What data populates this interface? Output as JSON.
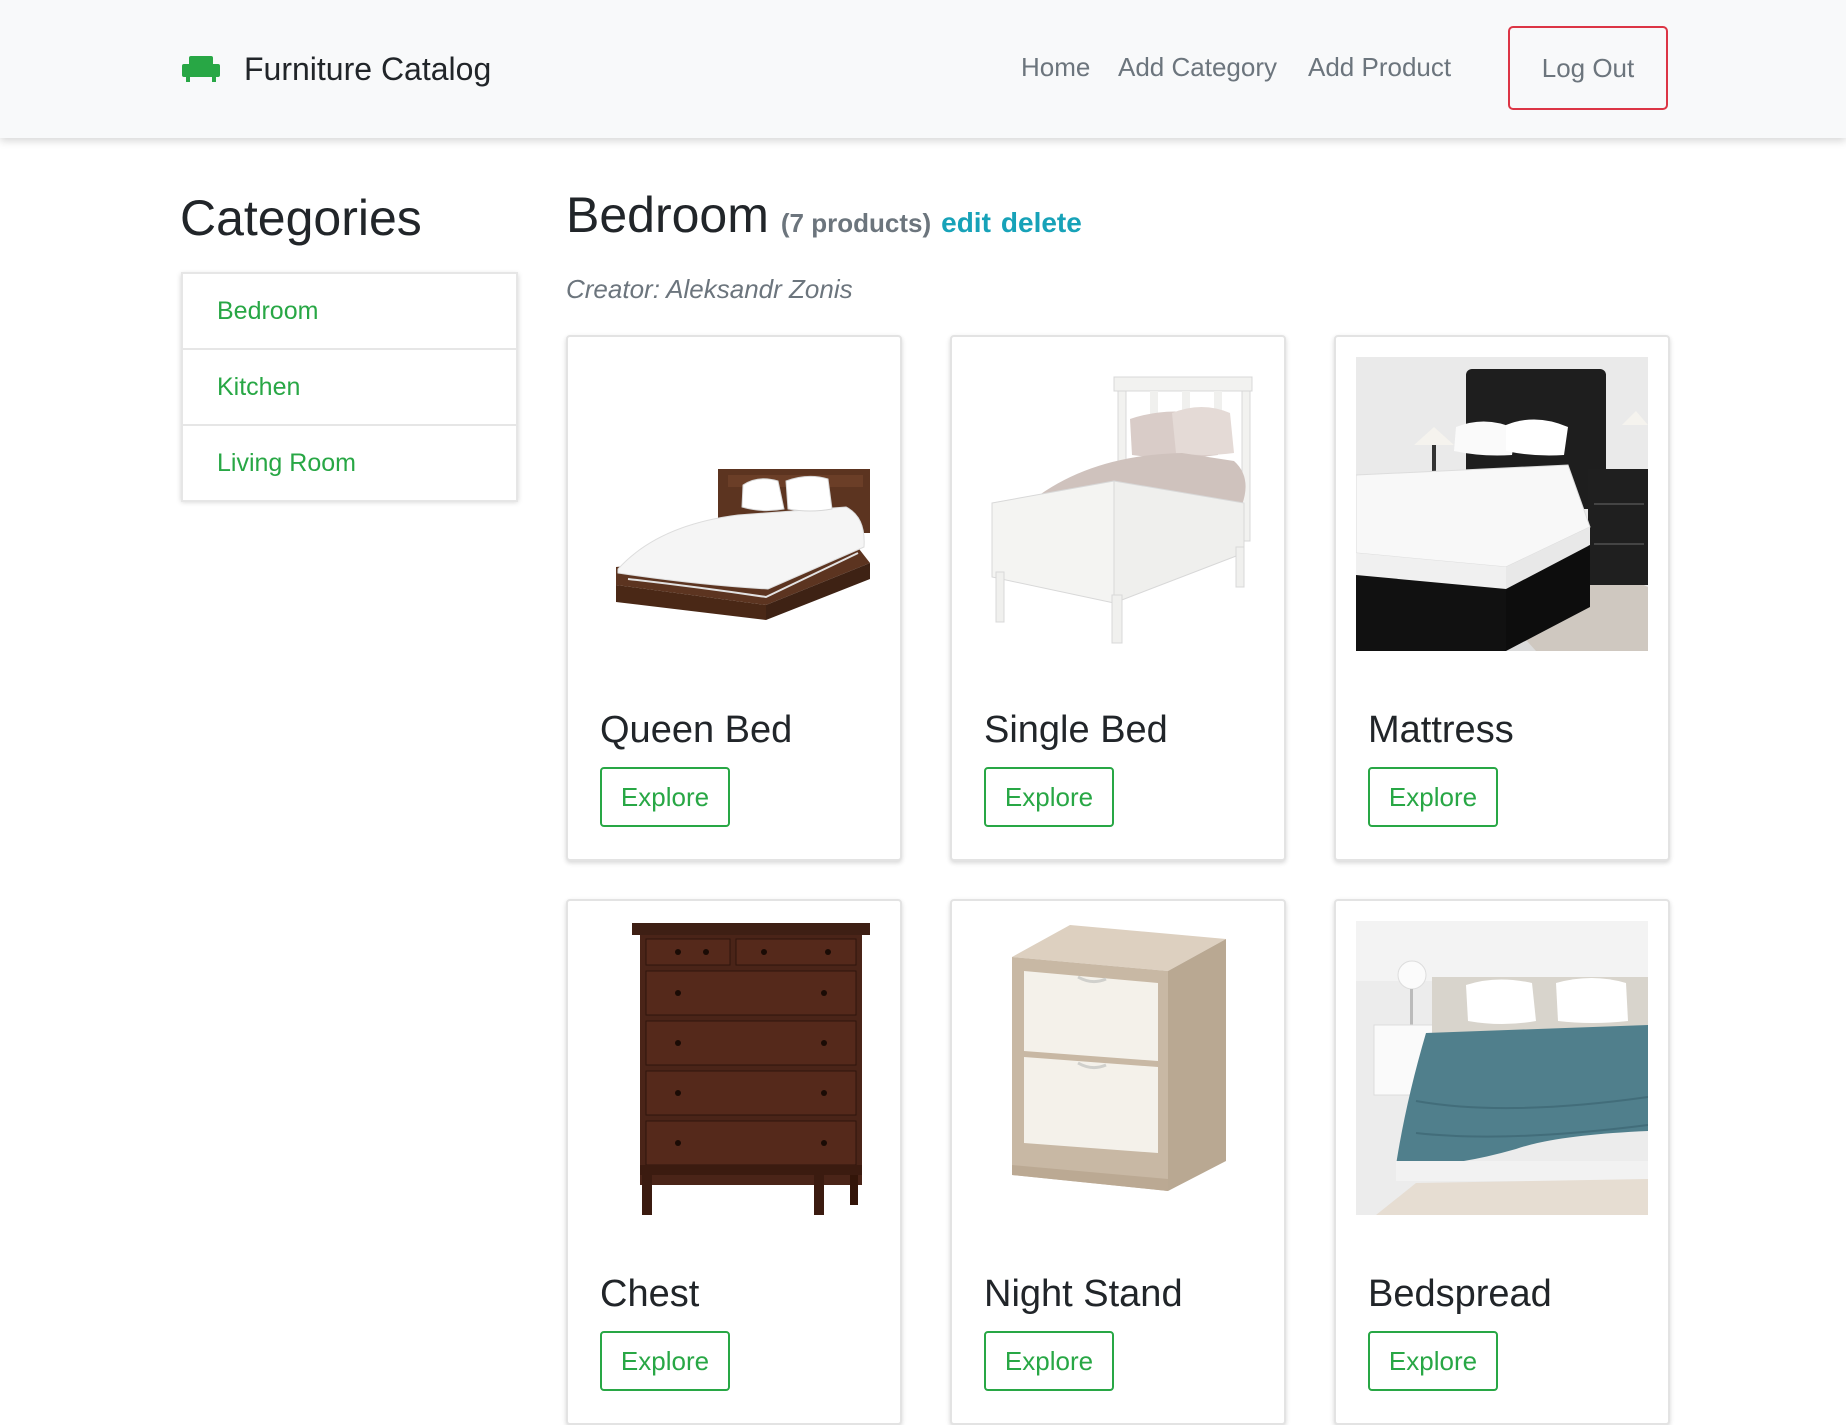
{
  "navbar": {
    "brand": "Furniture Catalog",
    "brand_icon": "sofa-icon",
    "links": [
      "Home",
      "Add Category",
      "Add Product"
    ],
    "logout": "Log Out"
  },
  "sidebar": {
    "heading": "Categories",
    "items": [
      {
        "label": "Bedroom"
      },
      {
        "label": "Kitchen"
      },
      {
        "label": "Living Room"
      }
    ]
  },
  "main": {
    "title": "Bedroom",
    "count": "(7 products)",
    "edit": "edit",
    "delete": "delete",
    "creator": "Creator: Aleksandr Zonis"
  },
  "products": [
    {
      "name": "Queen Bed",
      "button": "Explore"
    },
    {
      "name": "Single Bed",
      "button": "Explore"
    },
    {
      "name": "Mattress",
      "button": "Explore"
    },
    {
      "name": "Chest",
      "button": "Explore"
    },
    {
      "name": "Night Stand",
      "button": "Explore"
    },
    {
      "name": "Bedspread",
      "button": "Explore"
    }
  ],
  "colors": {
    "accent": "#28a745",
    "danger": "#dc3545",
    "info": "#17a2b8",
    "muted": "#6c757d"
  }
}
